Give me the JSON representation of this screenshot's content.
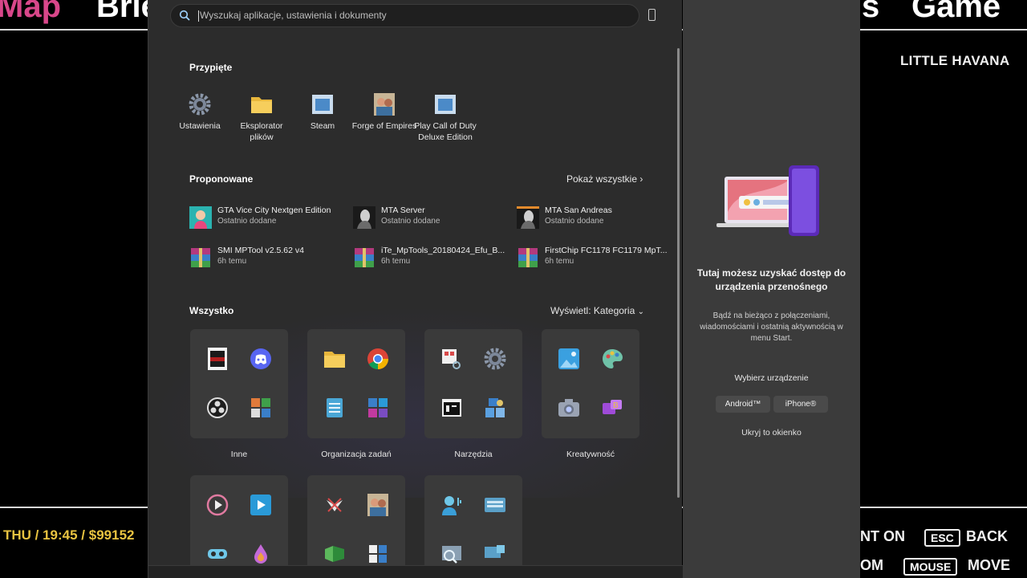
{
  "game": {
    "tabs": [
      "Map",
      "Brie",
      "s",
      "Game"
    ],
    "location": "LITTLE HAVANA",
    "status": "THU / 19:45 / $99152",
    "controls": [
      {
        "text": "NT ON"
      },
      {
        "key": "ESC",
        "text": "BACK"
      },
      {
        "text": "OM"
      },
      {
        "key": "MOUSE",
        "text": "MOVE"
      }
    ]
  },
  "search": {
    "placeholder": "Wyszukaj aplikacje, ustawienia i dokumenty"
  },
  "pinned": {
    "title": "Przypięte",
    "items": [
      {
        "label": "Ustawienia",
        "icon": "gear-icon"
      },
      {
        "label": "Eksplorator plików",
        "icon": "folder-icon"
      },
      {
        "label": "Steam",
        "icon": "app-window-icon"
      },
      {
        "label": "Forge of Empires",
        "icon": "forge-icon"
      },
      {
        "label": "Play Call of Duty Deluxe Edition",
        "icon": "app-window-icon"
      }
    ]
  },
  "recommended": {
    "title": "Proponowane",
    "show_all": "Pokaż wszystkie",
    "items": [
      {
        "title": "GTA Vice City Nextgen Edition",
        "sub": "Ostatnio dodane",
        "icon": "gta-icon"
      },
      {
        "title": "MTA Server",
        "sub": "Ostatnio dodane",
        "icon": "mta-icon"
      },
      {
        "title": "MTA San Andreas",
        "sub": "Ostatnio dodane",
        "icon": "mta-icon"
      },
      {
        "title": "SMI MPTool v2.5.62 v4",
        "sub": "6h temu",
        "icon": "winrar-icon"
      },
      {
        "title": "iTe_MpTools_20180424_Efu_B...",
        "sub": "6h temu",
        "icon": "winrar-icon"
      },
      {
        "title": "FirstChip FC1178 FC1179 MpT...",
        "sub": "6h temu",
        "icon": "winrar-icon"
      }
    ]
  },
  "all": {
    "title": "Wszystko",
    "view": "Wyświetl: Kategoria",
    "folders": [
      {
        "label": "Inne"
      },
      {
        "label": "Organizacja zadań"
      },
      {
        "label": "Narzędzia"
      },
      {
        "label": "Kreatywność"
      }
    ]
  },
  "phone_panel": {
    "title": "Tutaj możesz uzyskać dostęp do urządzenia przenośnego",
    "desc": "Bądź na bieżąco z połączeniami, wiadomościami i ostatnią aktywnością w menu Start.",
    "choose": "Wybierz urządzenie",
    "android": "Android™",
    "iphone": "iPhone®",
    "hide": "Ukryj to okienko"
  },
  "colors": {
    "accent": "#e8c341",
    "game_pink": "#d9478a",
    "panel": "#2c2c2c"
  }
}
